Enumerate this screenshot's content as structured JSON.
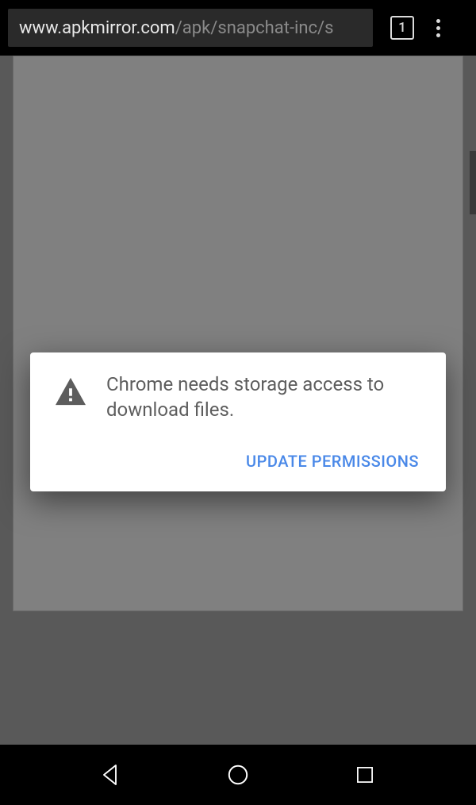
{
  "topbar": {
    "url_domain": "www.apkmirror.com",
    "url_path": "/apk/snapchat-inc/s",
    "tab_count": "1"
  },
  "dialog": {
    "message": "Chrome needs storage access to download files.",
    "action_label": "UPDATE PERMISSIONS"
  }
}
